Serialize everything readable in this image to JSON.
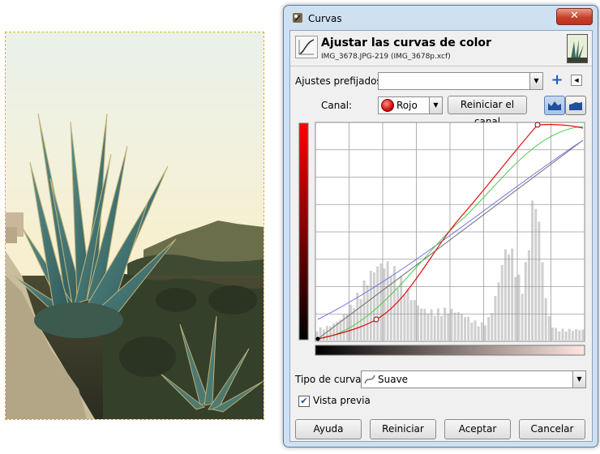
{
  "window": {
    "title": "Curvas",
    "close_label": "✕"
  },
  "header": {
    "title": "Ajustar las curvas de color",
    "subtitle": "IMG_3678.JPG-219 (IMG_3678p.xcf)"
  },
  "presets": {
    "label": "Ajustes prefijados:",
    "value": ""
  },
  "channel": {
    "label": "Canal:",
    "value": "Rojo",
    "reset_button": "Reiniciar el canal"
  },
  "curve_type": {
    "label": "Tipo de curva:",
    "value": "Suave"
  },
  "preview": {
    "label": "Vista previa",
    "checked": true
  },
  "buttons": {
    "help": "Ayuda",
    "reset": "Reiniciar",
    "ok": "Aceptar",
    "cancel": "Cancelar"
  },
  "colors": {
    "red_curve": "#e01010",
    "green_curve": "#4ccc4c",
    "blue_curve": "#6f6fe6",
    "histogram": "#cfcfcf",
    "selection_outline": "#d4b800"
  },
  "icons": {
    "add_preset": "plus-icon",
    "preset_menu": "menu-arrow-icon",
    "linear_histogram": "linear-histogram-icon",
    "log_histogram": "log-histogram-icon",
    "channel_color": "red-channel-icon",
    "curve_type": "smooth-curve-icon"
  }
}
